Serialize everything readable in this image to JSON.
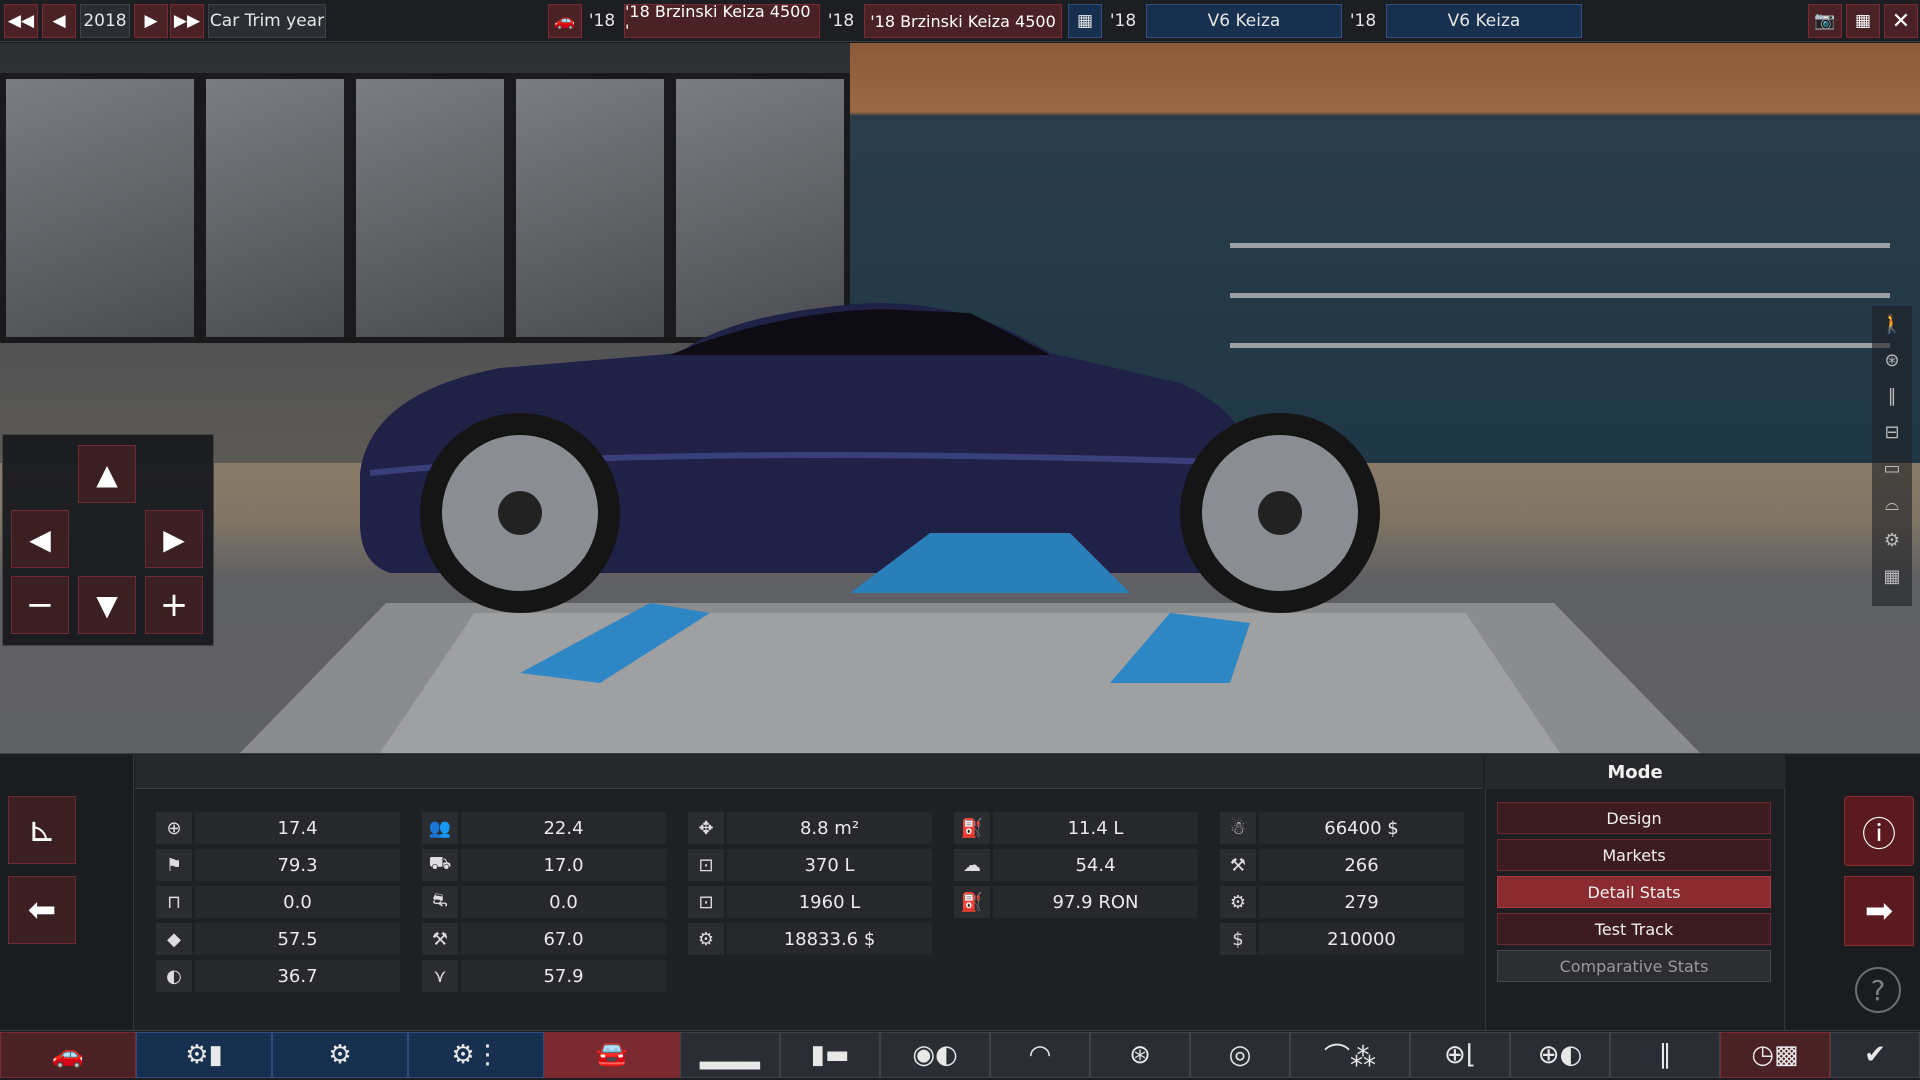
{
  "topbar": {
    "year": "2018",
    "trim_label": "Car Trim year",
    "model_year": "'18",
    "model_name": "'18 Brzinski Keiza 4500 '",
    "trim_year": "'18",
    "trim_name": "'18 Brzinski Keiza 4500 ",
    "engine_year": "'18",
    "engine_name": "V6 Keiza",
    "variant_year": "'18",
    "variant_name": "V6 Keiza",
    "icons": [
      "first-icon",
      "prev-icon",
      "next-icon",
      "last-icon",
      "car-icon",
      "engine-icon",
      "camera-icon",
      "calculator-icon",
      "close-icon"
    ]
  },
  "dpad": {
    "up": "▲",
    "left": "◀",
    "right": "▶",
    "down": "▼",
    "minus": "−",
    "plus": "+"
  },
  "stats": {
    "col1": [
      "17.4",
      "79.3",
      "0.0",
      "57.5",
      "36.7"
    ],
    "col2": [
      "22.4",
      "17.0",
      "0.0",
      "67.0",
      "57.9"
    ],
    "col3": [
      "8.8 m²",
      "370 L",
      "1960 L",
      "18833.6 $"
    ],
    "col4": [
      "11.4 L",
      "54.4",
      "97.9 RON"
    ],
    "col5": [
      "66400 $",
      "266",
      "279",
      "210000"
    ]
  },
  "mode": {
    "title": "Mode",
    "buttons": [
      "Design",
      "Markets",
      "Detail Stats",
      "Test Track",
      "Comparative Stats"
    ],
    "active": "Detail Stats"
  },
  "colors": {
    "accent_red": "#8a2b31",
    "button_red": "#3d1c20",
    "blue_tab": "#17304f"
  }
}
